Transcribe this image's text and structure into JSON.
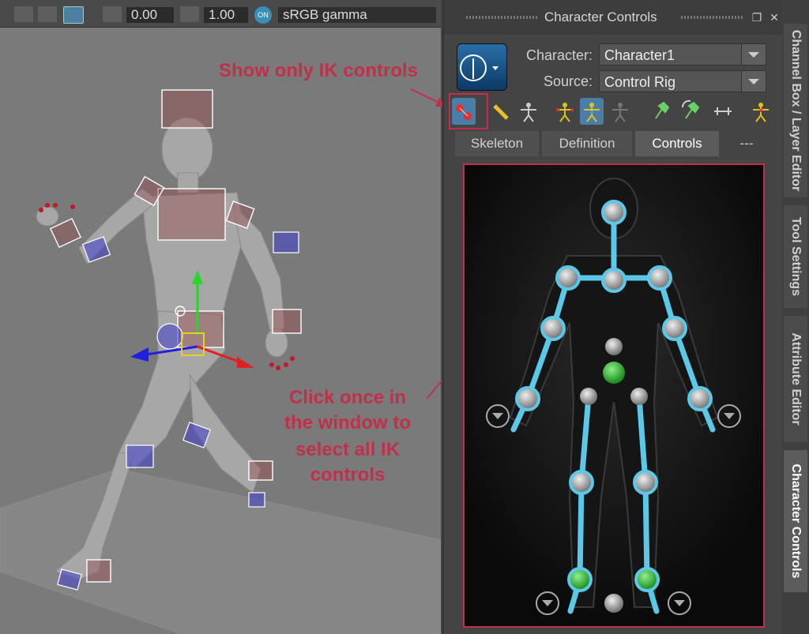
{
  "viewport": {
    "toolbar": {
      "exposure_value": "0.00",
      "gamma_value": "1.00",
      "color_mgmt_toggle": "ON",
      "color_space": "sRGB gamma"
    }
  },
  "panel": {
    "title": "Character Controls",
    "character_label": "Character:",
    "character_value": "Character1",
    "source_label": "Source:",
    "source_value": "Control Rig",
    "tabs": [
      {
        "label": "Skeleton",
        "active": false
      },
      {
        "label": "Definition",
        "active": false
      },
      {
        "label": "Controls",
        "active": true
      },
      {
        "label": "---",
        "active": false
      }
    ],
    "toolbar_icons": [
      "show-ik-controls-icon",
      "ruler-icon",
      "show-skeleton-icon",
      "select-all-ik-icon",
      "select-fk-icon",
      "hidden-figure-icon",
      "pin-translate-icon",
      "pin-rotate-icon",
      "pin-none-icon",
      "full-body-icon"
    ]
  },
  "side_tabs": [
    {
      "label": "Channel Box / Layer Editor",
      "active": false
    },
    {
      "label": "Tool Settings",
      "active": false
    },
    {
      "label": "Attribute Editor",
      "active": false
    },
    {
      "label": "Character Controls",
      "active": true
    }
  ],
  "annotations": {
    "ik_label": "Show only IK controls",
    "click_line1": "Click once in",
    "click_line2": "the window to",
    "click_line3": "select all IK",
    "click_line4": "controls"
  },
  "colors": {
    "annotation": "#c0304a",
    "bone_cyan": "#5bc8e8",
    "green_effector": "#3ec43e"
  }
}
